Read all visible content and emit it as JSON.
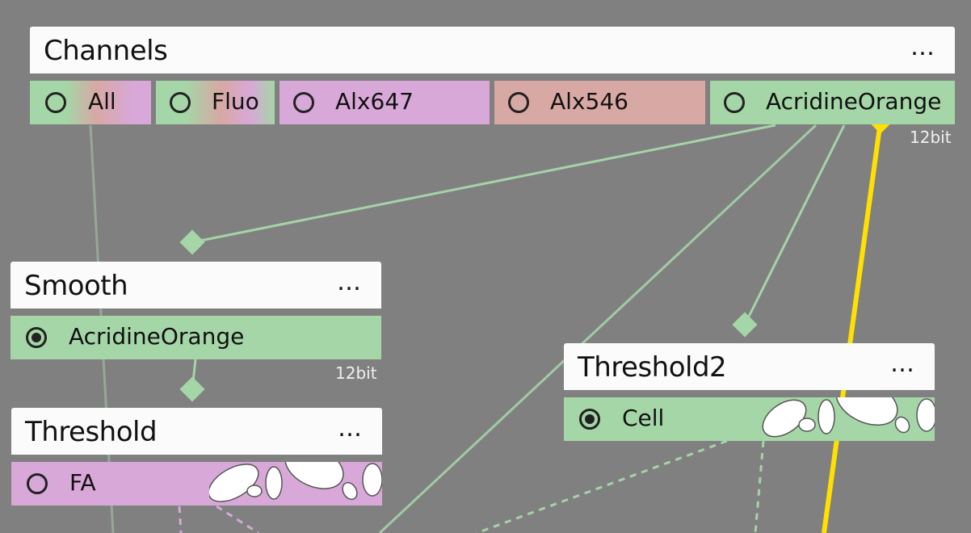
{
  "colors": {
    "background": "#808080",
    "green": "#a5d6a7",
    "purple": "#d8a8d8",
    "red": "#d8a8a4",
    "selected_wire": "#ffe000",
    "wire": "#a5d3a8"
  },
  "channels": {
    "title": "Channels",
    "menu": "…",
    "bit_depth": "12bit",
    "buttons": [
      {
        "label": "All",
        "color": "mixed"
      },
      {
        "label": "Fluo",
        "color": "mixed"
      },
      {
        "label": "Alx647",
        "color": "purple"
      },
      {
        "label": "Alx546",
        "color": "red"
      },
      {
        "label": "AcridineOrange",
        "color": "green"
      }
    ]
  },
  "smooth": {
    "title": "Smooth",
    "menu": "…",
    "channel": "AcridineOrange",
    "bit_depth": "12bit"
  },
  "threshold": {
    "title": "Threshold",
    "menu": "…",
    "channel": "FA"
  },
  "threshold2": {
    "title": "Threshold2",
    "menu": "…",
    "channel": "Cell"
  }
}
